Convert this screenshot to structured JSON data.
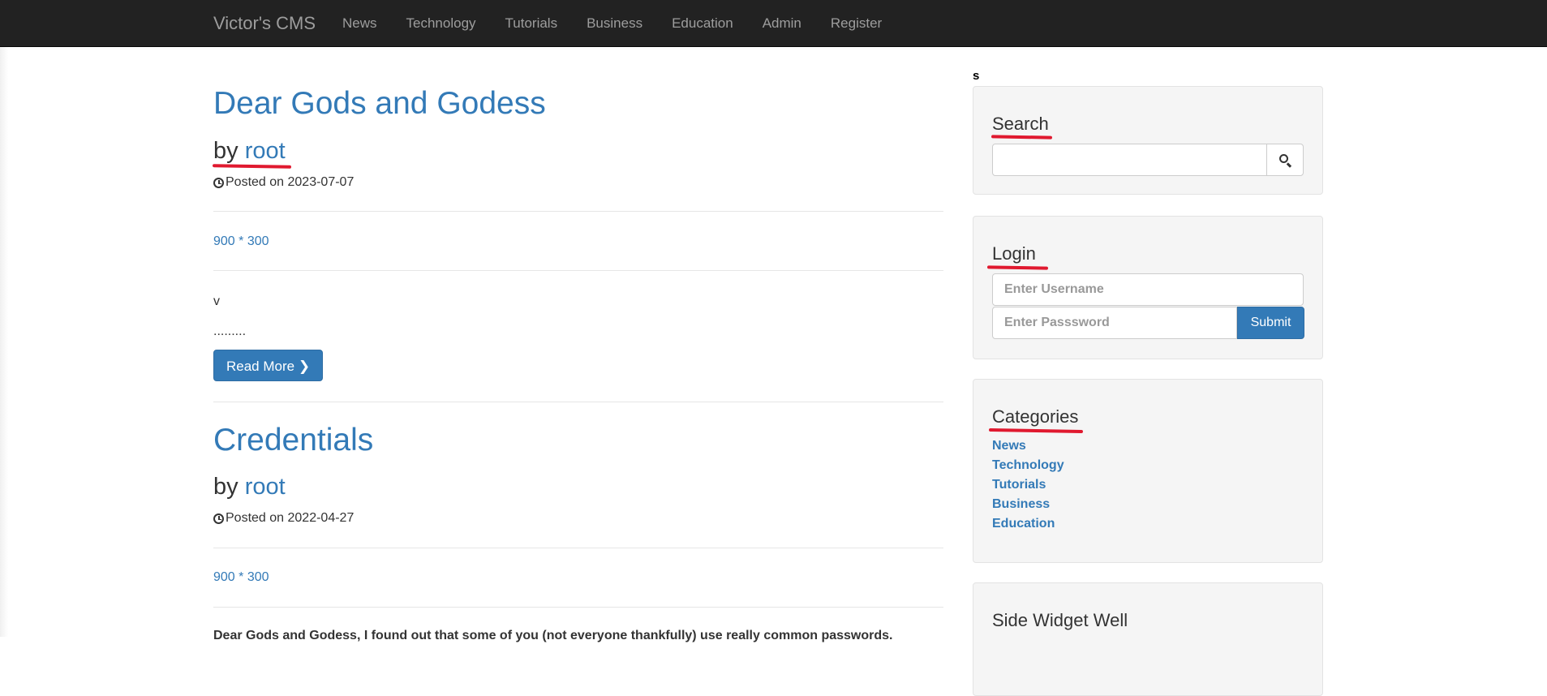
{
  "navbar": {
    "brand": "Victor's CMS",
    "items": [
      "News",
      "Technology",
      "Tutorials",
      "Business",
      "Education",
      "Admin",
      "Register"
    ]
  },
  "posts": [
    {
      "title": "Dear Gods and Godess",
      "by": "by",
      "author": "root",
      "posted": "Posted on 2023-07-07",
      "image_text": "900 * 300",
      "excerpt_line1": "v",
      "excerpt_line2": ".........",
      "read_more": "Read More"
    },
    {
      "title": "Credentials",
      "by": "by",
      "author": "root",
      "posted": "Posted on 2022-04-27",
      "image_text": "900 * 300",
      "excerpt_line1": "Dear Gods and Godess, I found out that some of you (not everyone thankfully) use really common passwords."
    }
  ],
  "sidebar": {
    "stray_text": "s",
    "search": {
      "title": "Search",
      "value": ""
    },
    "login": {
      "title": "Login",
      "username_placeholder": "Enter Username",
      "password_placeholder": "Enter Passsword",
      "submit_label": "Submit"
    },
    "categories": {
      "title": "Categories",
      "items": [
        "News",
        "Technology",
        "Tutorials",
        "Business",
        "Education"
      ]
    },
    "side_widget": {
      "title": "Side Widget Well"
    }
  },
  "colors": {
    "navbar_bg": "#222222",
    "link": "#337ab7",
    "annotation": "#e0192f"
  }
}
